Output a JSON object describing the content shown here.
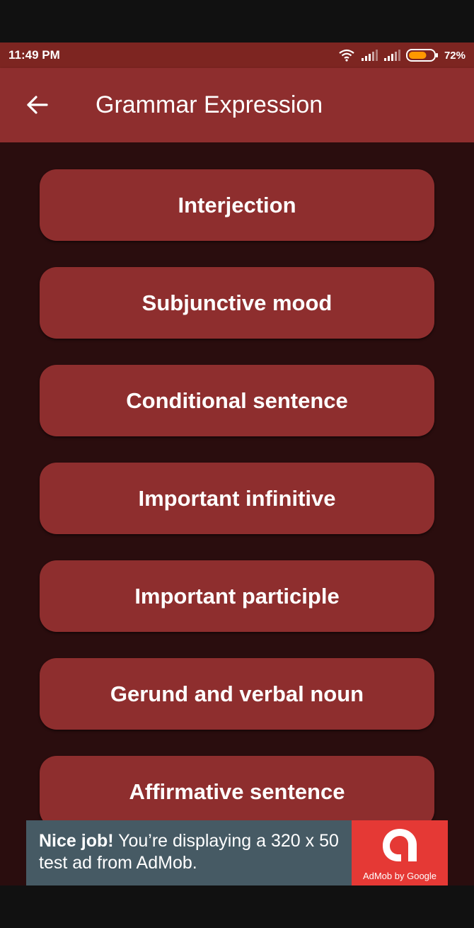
{
  "status_bar": {
    "time": "11:49 PM",
    "battery_percent": "72%",
    "battery_level": 0.72,
    "icons": [
      "wifi-icon",
      "signal-icon",
      "signal-icon",
      "battery-icon"
    ]
  },
  "app_bar": {
    "title": "Grammar Expression",
    "back_icon": "arrow-left-icon"
  },
  "menu": {
    "items": [
      {
        "label": "Interjection"
      },
      {
        "label": "Subjunctive mood"
      },
      {
        "label": "Conditional sentence"
      },
      {
        "label": "Important infinitive"
      },
      {
        "label": "Important participle"
      },
      {
        "label": "Gerund and verbal noun"
      },
      {
        "label": "Affirmative sentence"
      }
    ]
  },
  "ad": {
    "headline": "Nice job!",
    "body": " You’re displaying a 320 x 50 test ad from AdMob.",
    "logo_caption": "AdMob by Google"
  },
  "colors": {
    "status_bar": "#7d2521",
    "app_bar": "#8e2e2e",
    "background": "#2a0d0e",
    "button": "#8e2e2e",
    "ad_text_bg": "#465a64",
    "ad_logo_bg": "#e53935"
  }
}
